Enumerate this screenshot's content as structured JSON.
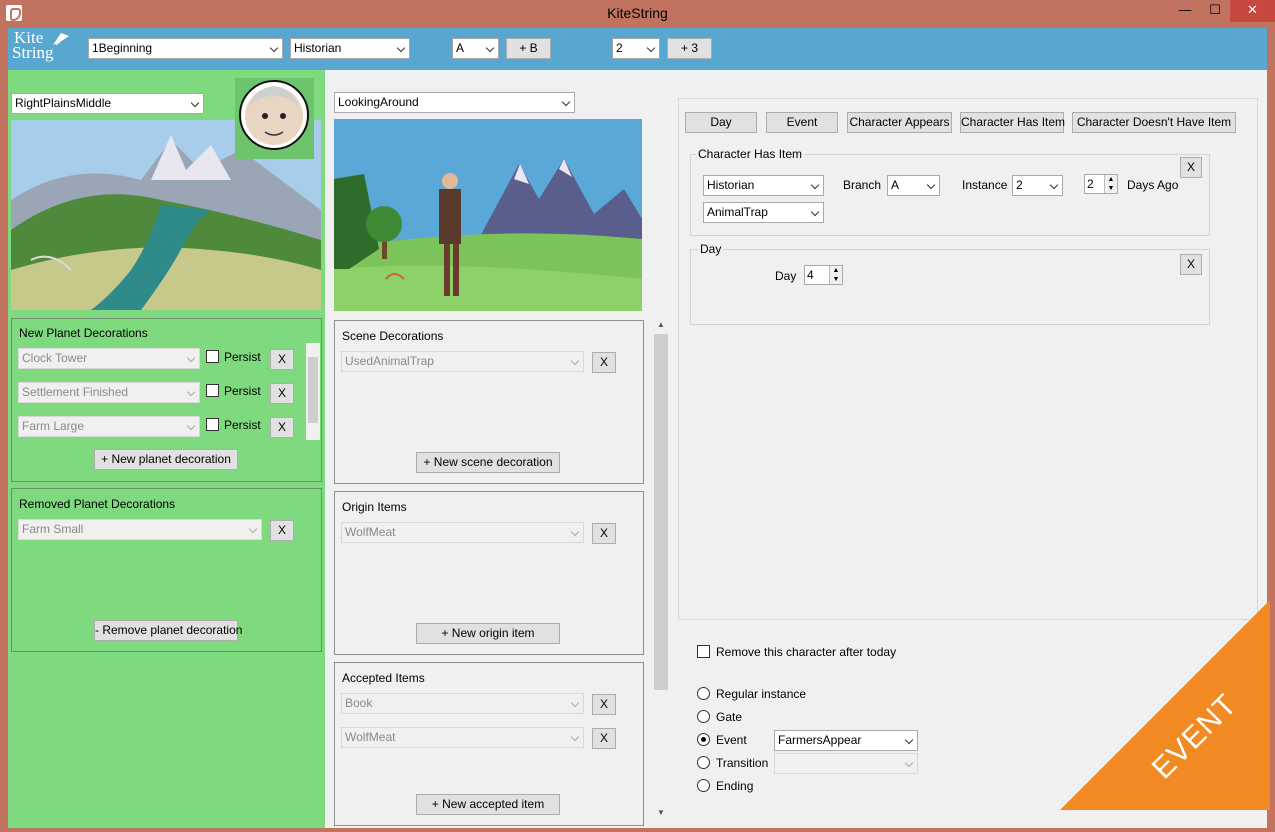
{
  "window": {
    "title": "KiteString",
    "minimize": "—",
    "maximize": "☐",
    "close": "✕"
  },
  "logo": {
    "line1": "Kite",
    "line2": "String"
  },
  "header": {
    "chapter": "1Beginning",
    "character": "Historian",
    "branch": "A",
    "add_branch": "+ B",
    "instance": "2",
    "add_instance": "+ 3"
  },
  "planet": {
    "location": "RightPlainsMiddle",
    "new_decorations": {
      "title": "New Planet Decorations",
      "items": [
        {
          "value": "Clock Tower",
          "persist_label": "Persist",
          "remove": "X"
        },
        {
          "value": "Settlement Finished",
          "persist_label": "Persist",
          "remove": "X"
        },
        {
          "value": "Farm Large",
          "persist_label": "Persist",
          "remove": "X"
        }
      ],
      "add_label": "+ New planet decoration"
    },
    "removed_decorations": {
      "title": "Removed Planet Decorations",
      "items": [
        {
          "value": "Farm Small",
          "remove": "X"
        }
      ],
      "remove_label": "- Remove planet decoration"
    }
  },
  "scene": {
    "name": "LookingAround",
    "decorations": {
      "title": "Scene Decorations",
      "items": [
        {
          "value": "UsedAnimalTrap",
          "remove": "X"
        }
      ],
      "add_label": "+ New scene decoration"
    },
    "origin_items": {
      "title": "Origin Items",
      "items": [
        {
          "value": "WolfMeat",
          "remove": "X"
        }
      ],
      "add_label": "+ New origin item"
    },
    "accepted_items": {
      "title": "Accepted Items",
      "items": [
        {
          "value": "Book",
          "remove": "X"
        },
        {
          "value": "WolfMeat",
          "remove": "X"
        }
      ],
      "add_label": "+ New accepted item"
    }
  },
  "conditions": {
    "buttons": [
      "Day",
      "Event",
      "Character Appears",
      "Character Has Item",
      "Character Doesn't Have Item"
    ],
    "has_item": {
      "title": "Character Has Item",
      "character": "Historian",
      "branch_label": "Branch",
      "branch": "A",
      "instance_label": "Instance",
      "instance": "2",
      "days_ago_value": "2",
      "days_ago_label": "Days Ago",
      "item": "AnimalTrap",
      "remove": "X"
    },
    "day": {
      "title": "Day",
      "day_label": "Day",
      "day_value": "4",
      "remove": "X"
    }
  },
  "footer": {
    "remove_character_label": "Remove this character after today",
    "options": [
      {
        "label": "Regular instance",
        "selected": false
      },
      {
        "label": "Gate",
        "selected": false
      },
      {
        "label": "Event",
        "selected": true
      },
      {
        "label": "Transition",
        "selected": false
      },
      {
        "label": "Ending",
        "selected": false
      }
    ],
    "event_value": "FarmersAppear",
    "transition_value": ""
  },
  "banner": {
    "text": "EVENT",
    "color": "#f28a24"
  },
  "colors": {
    "header": "#57a7d1",
    "left_panel": "#7fd97f",
    "titlebar": "#c1735f"
  }
}
